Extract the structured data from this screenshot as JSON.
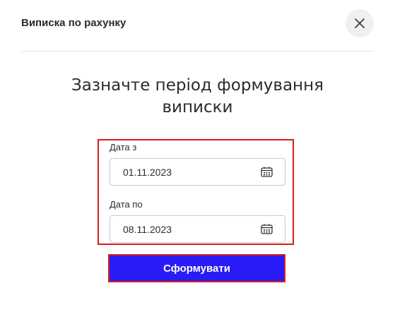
{
  "modal": {
    "title": "Виписка по рахунку",
    "close_icon": "close-icon"
  },
  "heading": {
    "line1": "Зазначте період формування",
    "line2": "виписки"
  },
  "form": {
    "from_label": "Дата з",
    "from_value": "01.11.2023",
    "to_label": "Дата по",
    "to_value": "08.11.2023",
    "calendar_icon": "calendar-icon",
    "submit_label": "Сформувати"
  },
  "colors": {
    "accent": "#2a1cf7",
    "highlight_border": "#d81b1b",
    "close_bg": "#f0f0f0"
  }
}
